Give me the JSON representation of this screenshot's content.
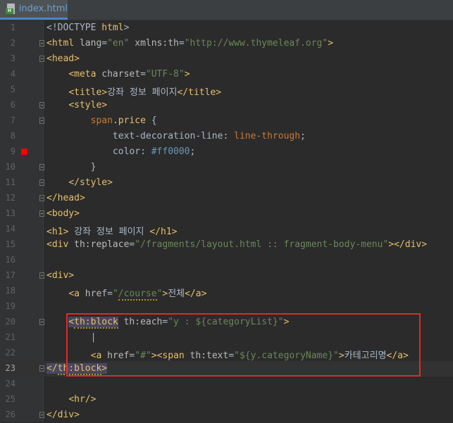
{
  "tab": {
    "file_name": "index.html",
    "file_icon": "html-file-icon"
  },
  "editor": {
    "lines": [
      {
        "n": "1"
      },
      {
        "n": "2"
      },
      {
        "n": "3"
      },
      {
        "n": "4"
      },
      {
        "n": "5"
      },
      {
        "n": "6"
      },
      {
        "n": "7"
      },
      {
        "n": "8"
      },
      {
        "n": "9"
      },
      {
        "n": "10"
      },
      {
        "n": "11"
      },
      {
        "n": "12"
      },
      {
        "n": "13"
      },
      {
        "n": "14"
      },
      {
        "n": "15"
      },
      {
        "n": "16"
      },
      {
        "n": "17"
      },
      {
        "n": "18"
      },
      {
        "n": "19"
      },
      {
        "n": "20"
      },
      {
        "n": "21"
      },
      {
        "n": "22"
      },
      {
        "n": "23"
      },
      {
        "n": "24"
      },
      {
        "n": "25"
      },
      {
        "n": "26"
      }
    ],
    "current_line": "23",
    "color_swatch": "#ff0000",
    "highlight_color": "#e02a2a"
  },
  "code": {
    "l1_a": "<!DOCTYPE ",
    "l1_b": "html",
    "l1_c": ">",
    "l2_tag": "<html ",
    "l2_attr1": "lang",
    "l2_val1": "\"en\"",
    "l2_attr2": " xmlns:th",
    "l2_val2": "\"http://www.thymeleaf.org\"",
    "l2_end": ">",
    "l3": "<head>",
    "l4_tag": "<meta ",
    "l4_attr": "charset",
    "l4_val": "\"UTF-8\"",
    "l4_end": ">",
    "l5_open": "<title>",
    "l5_text": "강좌 정보 페이지",
    "l5_close": "</title>",
    "l6": "<style>",
    "l7_sel": "span",
    "l7_cls": ".price",
    "l7_brace": " {",
    "l8_prop": "text-decoration-line",
    "l8_val": "line-through",
    "l9_prop": "color",
    "l9_val": "#ff0000",
    "l10": "}",
    "l11": "</style>",
    "l12": "</head>",
    "l13": "<body>",
    "l14_open": "<h1>",
    "l14_text": " 강좌 정보 페이지 ",
    "l14_close": "</h1>",
    "l15_tag": "<div ",
    "l15_attr": "th:replace",
    "l15_val": "\"/fragments/layout.html :: fragment-body-menu\"",
    "l15_end": "></div>",
    "l17": "<div>",
    "l18_tag": "<a ",
    "l18_attr": "href",
    "l18_val_q": "\"",
    "l18_val": "/course",
    "l18_val_q2": "\"",
    "l18_gt": ">",
    "l18_text": "전체",
    "l18_close": "</a>",
    "l20_lt": "<",
    "l20_tag": "th:block",
    "l20_attr": " th:each",
    "l20_val": "\"y : ${categoryList}\"",
    "l20_end": ">",
    "l21": "|",
    "l22_tag": "<a ",
    "l22_attr": "href",
    "l22_val": "\"#\"",
    "l22_gt": ">",
    "l22_span": "<span ",
    "l22_attr2": "th:text",
    "l22_val2": "\"${y.categoryName}\"",
    "l22_gt2": ">",
    "l22_text": "카테고리명",
    "l22_close": "</",
    "l22_close2": "a>",
    "l23_a": "</",
    "l23_b": "th:block",
    "l23_c": ">",
    "l25": "<hr/>",
    "l26": "</div>"
  }
}
